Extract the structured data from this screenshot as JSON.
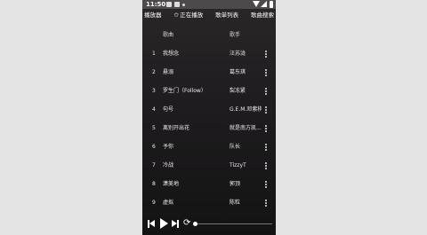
{
  "status": {
    "time": "11:50"
  },
  "tabs": [
    {
      "label": "播放器"
    },
    {
      "label": "正在播放",
      "icon": "star-icon"
    },
    {
      "label": "歌单列表"
    },
    {
      "label": "歌曲搜索"
    }
  ],
  "table": {
    "headers": {
      "title": "歌曲",
      "artist": "歌手"
    },
    "rows": [
      {
        "num": "1",
        "title": "我想念",
        "artist": "汪苏泷"
      },
      {
        "num": "2",
        "title": "悬溺",
        "artist": "葛东琪"
      },
      {
        "num": "3",
        "title": "罗生门（Follow）",
        "artist": "梨冻紧"
      },
      {
        "num": "4",
        "title": "句号",
        "artist": "G.E.M.邓紫棋"
      },
      {
        "num": "5",
        "title": "离别开出花",
        "artist": "就是南方凯..."
      },
      {
        "num": "6",
        "title": "予你",
        "artist": "队长"
      },
      {
        "num": "7",
        "title": "冷战",
        "artist": "TizzyT"
      },
      {
        "num": "8",
        "title": "潇美地",
        "artist": "郭顶"
      },
      {
        "num": "9",
        "title": "虚拟",
        "artist": "陈粒"
      }
    ]
  },
  "player": {
    "progress": 0.0
  }
}
